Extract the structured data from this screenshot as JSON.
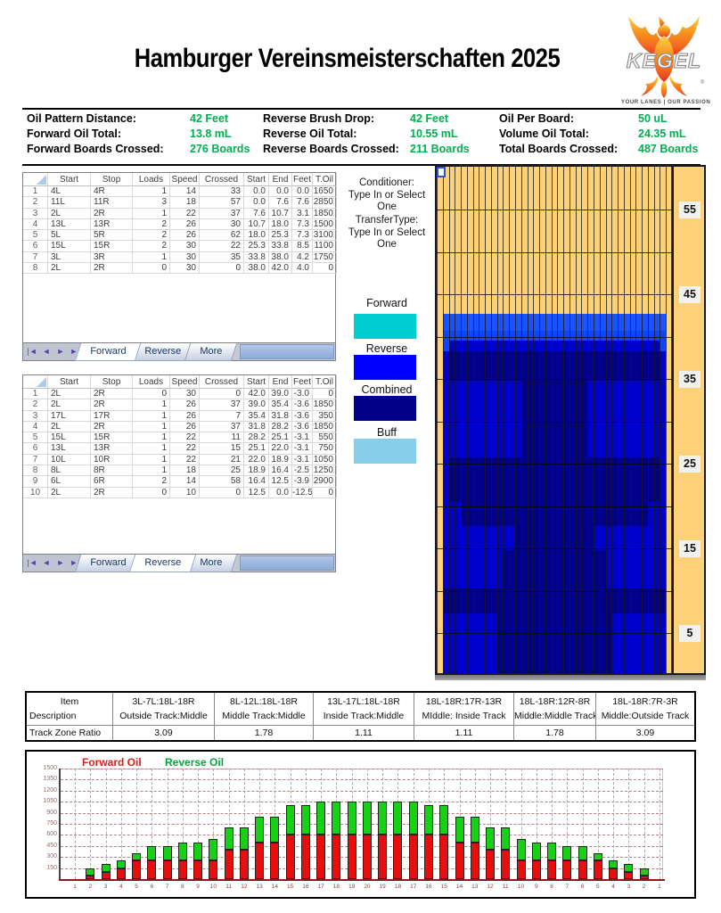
{
  "title": "Hamburger Vereinsmeisterschaften 2025",
  "logo": {
    "brand": "KEGEL",
    "tagline": "YOUR LANES | OUR PASSION"
  },
  "info": {
    "columns": [
      {
        "rows": [
          {
            "label": "Oil Pattern Distance:",
            "value": "42 Feet"
          },
          {
            "label": "Forward Oil Total:",
            "value": "13.8 mL"
          },
          {
            "label": "Forward Boards Crossed:",
            "value": "276 Boards"
          }
        ]
      },
      {
        "rows": [
          {
            "label": "Reverse Brush Drop:",
            "value": "42 Feet"
          },
          {
            "label": "Reverse Oil Total:",
            "value": "10.55 mL"
          },
          {
            "label": "Reverse Boards Crossed:",
            "value": "211 Boards"
          }
        ]
      },
      {
        "rows": [
          {
            "label": "Oil Per Board:",
            "value": "50 uL"
          },
          {
            "label": "Volume Oil Total:",
            "value": "24.35 mL"
          },
          {
            "label": "Total Boards Crossed:",
            "value": "487 Boards"
          }
        ]
      }
    ]
  },
  "tables": {
    "columns": [
      "Start",
      "Stop",
      "Loads",
      "Speed",
      "Crossed",
      "Start",
      "End",
      "Feet",
      "T.Oil"
    ],
    "tabs": [
      "Forward",
      "Reverse",
      "More"
    ],
    "nav_icons": [
      "|◄",
      "◄",
      "►",
      "►|"
    ],
    "forward": {
      "active_tab": "Forward",
      "rows": [
        [
          "4L",
          "4R",
          "1",
          "14",
          "33",
          "0.0",
          "0.0",
          "0.0",
          "1650"
        ],
        [
          "11L",
          "11R",
          "3",
          "18",
          "57",
          "0.0",
          "7.6",
          "7.6",
          "2850"
        ],
        [
          "2L",
          "2R",
          "1",
          "22",
          "37",
          "7.6",
          "10.7",
          "3.1",
          "1850"
        ],
        [
          "13L",
          "13R",
          "2",
          "26",
          "30",
          "10.7",
          "18.0",
          "7.3",
          "1500"
        ],
        [
          "5L",
          "5R",
          "2",
          "26",
          "62",
          "18.0",
          "25.3",
          "7.3",
          "3100"
        ],
        [
          "15L",
          "15R",
          "2",
          "30",
          "22",
          "25.3",
          "33.8",
          "8.5",
          "1100"
        ],
        [
          "3L",
          "3R",
          "1",
          "30",
          "35",
          "33.8",
          "38.0",
          "4.2",
          "1750"
        ],
        [
          "2L",
          "2R",
          "0",
          "30",
          "0",
          "38.0",
          "42.0",
          "4.0",
          "0"
        ]
      ]
    },
    "reverse": {
      "active_tab": "Reverse",
      "rows": [
        [
          "2L",
          "2R",
          "0",
          "30",
          "0",
          "42.0",
          "39.0",
          "-3.0",
          "0"
        ],
        [
          "2L",
          "2R",
          "1",
          "26",
          "37",
          "39.0",
          "35.4",
          "-3.6",
          "1850"
        ],
        [
          "17L",
          "17R",
          "1",
          "26",
          "7",
          "35.4",
          "31.8",
          "-3.6",
          "350"
        ],
        [
          "2L",
          "2R",
          "1",
          "26",
          "37",
          "31.8",
          "28.2",
          "-3.6",
          "1850"
        ],
        [
          "15L",
          "15R",
          "1",
          "22",
          "11",
          "28.2",
          "25.1",
          "-3.1",
          "550"
        ],
        [
          "13L",
          "13R",
          "1",
          "22",
          "15",
          "25.1",
          "22.0",
          "-3.1",
          "750"
        ],
        [
          "10L",
          "10R",
          "1",
          "22",
          "21",
          "22.0",
          "18.9",
          "-3.1",
          "1050"
        ],
        [
          "8L",
          "8R",
          "1",
          "18",
          "25",
          "18.9",
          "16.4",
          "-2.5",
          "1250"
        ],
        [
          "6L",
          "6R",
          "2",
          "14",
          "58",
          "16.4",
          "12.5",
          "-3.9",
          "2900"
        ],
        [
          "2L",
          "2R",
          "0",
          "10",
          "0",
          "12.5",
          "0.0",
          "-12.5",
          "0"
        ]
      ]
    }
  },
  "legend": {
    "conditioner_label": "Conditioner:",
    "conditioner_value": "Type In or Select One",
    "transfer_label": "TransferType:",
    "transfer_value": "Type In or Select One",
    "swatches": [
      {
        "label": "Forward",
        "color": "#00CED1"
      },
      {
        "label": "Reverse",
        "color": "#0000FF"
      },
      {
        "label": "Combined",
        "color": "#00008B"
      },
      {
        "label": "Buff",
        "color": "#87CEEB"
      }
    ]
  },
  "lane": {
    "distance_labels": [
      55,
      45,
      35,
      25,
      15,
      5
    ],
    "boards": 39,
    "colors": {
      "lane": "#FDD177",
      "b1": "#1B52FF",
      "b2": "#0D45FF",
      "cd": "#0000CD",
      "dk": "#00008B"
    },
    "pattern_zones": [
      {
        "y": [
          165,
          184
        ],
        "segs": [
          [
            2,
            38,
            "b1"
          ]
        ]
      },
      {
        "y": [
          184,
          195
        ],
        "segs": [
          [
            2,
            38,
            "b2"
          ]
        ]
      },
      {
        "y": [
          195,
          207
        ],
        "segs": [
          [
            2,
            2,
            "b2"
          ],
          [
            3,
            37,
            "cd"
          ],
          [
            38,
            38,
            "b2"
          ]
        ]
      },
      {
        "y": [
          207,
          240
        ],
        "segs": [
          [
            2,
            2,
            "cd"
          ],
          [
            3,
            37,
            "dk"
          ],
          [
            38,
            38,
            "cd"
          ]
        ]
      },
      {
        "y": [
          240,
          326
        ],
        "segs": [
          [
            2,
            14,
            "cd"
          ],
          [
            15,
            25,
            "dk"
          ],
          [
            26,
            38,
            "cd"
          ]
        ]
      },
      {
        "y": [
          326,
          376
        ],
        "segs": [
          [
            2,
            2,
            "cd"
          ],
          [
            3,
            37,
            "dk"
          ],
          [
            38,
            38,
            "cd"
          ]
        ]
      },
      {
        "y": [
          376,
          403
        ],
        "segs": [
          [
            2,
            4,
            "cd"
          ],
          [
            5,
            35,
            "dk"
          ],
          [
            36,
            38,
            "cd"
          ]
        ]
      },
      {
        "y": [
          403,
          430
        ],
        "segs": [
          [
            2,
            13,
            "cd"
          ],
          [
            14,
            26,
            "dk"
          ],
          [
            27,
            38,
            "cd"
          ]
        ]
      },
      {
        "y": [
          430,
          473
        ],
        "segs": [
          [
            2,
            11,
            "cd"
          ],
          [
            12,
            28,
            "dk"
          ],
          [
            29,
            38,
            "cd"
          ]
        ]
      },
      {
        "y": [
          473,
          501
        ],
        "segs": [
          [
            2,
            38,
            "dk"
          ]
        ]
      },
      {
        "y": [
          501,
          568
        ],
        "segs": [
          [
            2,
            10,
            "cd"
          ],
          [
            11,
            29,
            "dk"
          ],
          [
            30,
            38,
            "cd"
          ]
        ]
      }
    ]
  },
  "ratio_table": {
    "row_headers": [
      "Item",
      "Description",
      "Track Zone Ratio"
    ],
    "columns": [
      {
        "item": "3L-7L:18L-18R",
        "description": "Outside Track:Middle",
        "ratio": "3.09"
      },
      {
        "item": "8L-12L:18L-18R",
        "description": "Middle Track:Middle",
        "ratio": "1.78"
      },
      {
        "item": "13L-17L:18L-18R",
        "description": "Inside Track:Middle",
        "ratio": "1.11"
      },
      {
        "item": "18L-18R:17R-13R",
        "description": "MIddle: Inside Track",
        "ratio": "1.11"
      },
      {
        "item": "18L-18R:12R-8R",
        "description": "Middle:Middle Track",
        "ratio": "1.78"
      },
      {
        "item": "18L-18R:7R-3R",
        "description": "Middle:Outside Track",
        "ratio": "3.09"
      }
    ]
  },
  "chart_data": {
    "type": "bar",
    "stacked": true,
    "categories": [
      1,
      2,
      3,
      4,
      5,
      6,
      7,
      8,
      9,
      10,
      11,
      12,
      13,
      14,
      15,
      16,
      17,
      18,
      19,
      20,
      19,
      18,
      17,
      16,
      15,
      14,
      13,
      12,
      11,
      10,
      9,
      8,
      7,
      6,
      5,
      4,
      3,
      2,
      1
    ],
    "series": [
      {
        "name": "Forward Oil",
        "color": "#E80E0E",
        "values": [
          0,
          50,
          100,
          150,
          250,
          250,
          250,
          250,
          250,
          250,
          400,
          400,
          500,
          500,
          600,
          600,
          600,
          600,
          600,
          600,
          600,
          600,
          600,
          600,
          600,
          500,
          500,
          400,
          400,
          250,
          250,
          250,
          250,
          250,
          250,
          150,
          100,
          50,
          0
        ]
      },
      {
        "name": "Reverse Oil",
        "color": "#17D117",
        "values": [
          0,
          100,
          100,
          100,
          100,
          200,
          200,
          250,
          250,
          300,
          300,
          300,
          350,
          350,
          400,
          400,
          450,
          450,
          450,
          450,
          450,
          450,
          450,
          400,
          400,
          350,
          350,
          300,
          300,
          300,
          250,
          250,
          200,
          200,
          100,
          100,
          100,
          100,
          0
        ]
      }
    ],
    "ylim": [
      0,
      1500
    ],
    "ytick": 150,
    "grid": true,
    "legend_position": "top-left"
  }
}
